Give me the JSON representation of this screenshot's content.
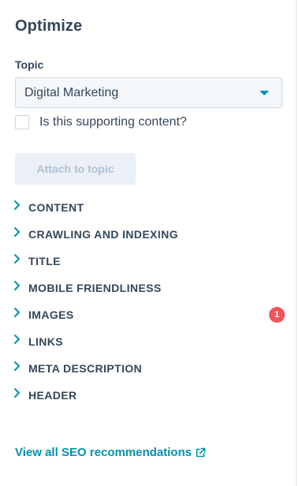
{
  "panel": {
    "title": "Optimize",
    "topic": {
      "label": "Topic",
      "selected": "Digital Marketing"
    },
    "supporting_checkbox": {
      "label": "Is this supporting content?",
      "checked": false
    },
    "attach_button": {
      "label": "Attach to topic",
      "enabled": false
    },
    "sections": [
      {
        "label": "CONTENT",
        "badge": ""
      },
      {
        "label": "CRAWLING AND INDEXING",
        "badge": ""
      },
      {
        "label": "TITLE",
        "badge": ""
      },
      {
        "label": "MOBILE FRIENDLINESS",
        "badge": ""
      },
      {
        "label": "IMAGES",
        "badge": "1"
      },
      {
        "label": "LINKS",
        "badge": ""
      },
      {
        "label": "META DESCRIPTION",
        "badge": ""
      },
      {
        "label": "HEADER",
        "badge": ""
      }
    ],
    "footer_link": {
      "label": "View all SEO recommendations",
      "icon": "external-link-icon"
    }
  },
  "colors": {
    "text": "#33475b",
    "accent": "#0091ae",
    "badge": "#f2545b",
    "disabled_bg": "#eaf0f6",
    "disabled_text": "#b0c1d4"
  }
}
